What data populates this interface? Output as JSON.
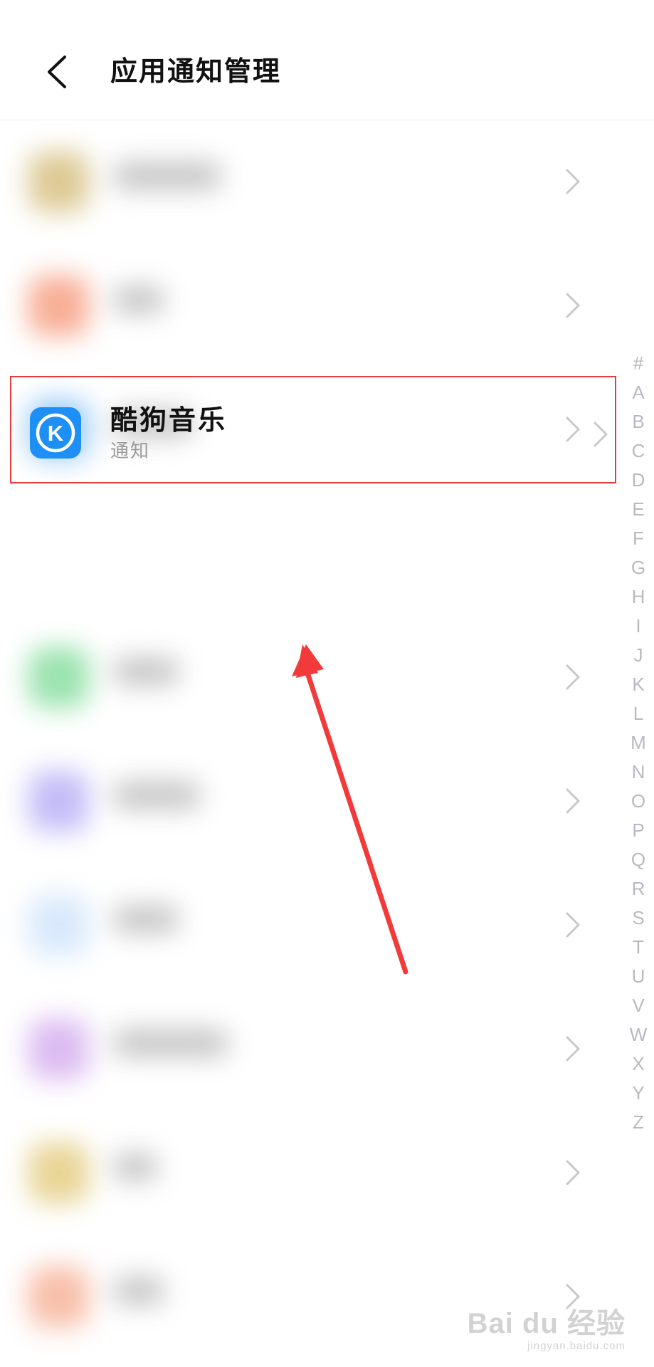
{
  "header": {
    "title": "应用通知管理",
    "back_icon": "chevron-left-icon"
  },
  "colors": {
    "highlight_border": "#e83a3a",
    "app_icon_bg": "#1e8ff5",
    "arrow": "#f23a3a",
    "chevron": "#c8c8cc"
  },
  "app_list": {
    "blurred_icon_colors": [
      "#d9c48a",
      "#f7a58a",
      "#8fc6f7",
      "#8fe0a6",
      "#bdb6f7",
      "#d4e6fb",
      "#d8b4f0",
      "#e6d08a",
      "#f7b8a0"
    ],
    "highlighted_item": {
      "name": "酷狗音乐",
      "subtitle": "通知",
      "icon": "kugou-music-icon",
      "icon_letter": "K"
    }
  },
  "alphabet_index": [
    "#",
    "A",
    "B",
    "C",
    "D",
    "E",
    "F",
    "G",
    "H",
    "I",
    "J",
    "K",
    "L",
    "M",
    "N",
    "O",
    "P",
    "Q",
    "R",
    "S",
    "T",
    "U",
    "V",
    "W",
    "X",
    "Y",
    "Z"
  ],
  "watermark": {
    "main": "Bai du 经验",
    "sub": "jingyan.baidu.com"
  }
}
